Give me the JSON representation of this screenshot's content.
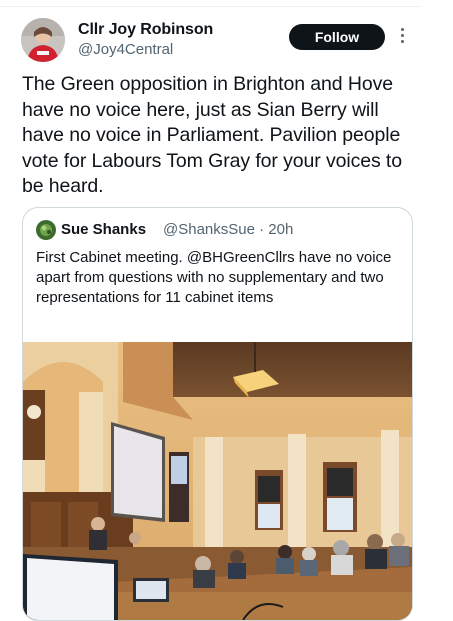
{
  "author": {
    "display_name": "Cllr Joy Robinson",
    "handle": "@Joy4Central",
    "avatar_icon": "profile-photo"
  },
  "follow_label": "Follow",
  "post_text": "The Green opposition in Brighton and Hove have no voice here, just as Sian Berry will have no voice in Parliament. Pavilion people vote for Labours Tom Gray for your voices to be heard.",
  "quoted": {
    "display_name": "Sue Shanks",
    "handle_time": "@ShanksSue · 20h",
    "text": "First Cabinet meeting. @BHGreenCllrs have no voice apart from questions with no supplementary and two representations for 11 cabinet items",
    "media": "council-chamber-photo"
  },
  "colors": {
    "text": "#0f1419",
    "secondary": "#536471",
    "border": "#cfd9de",
    "button": "#0f1419"
  }
}
